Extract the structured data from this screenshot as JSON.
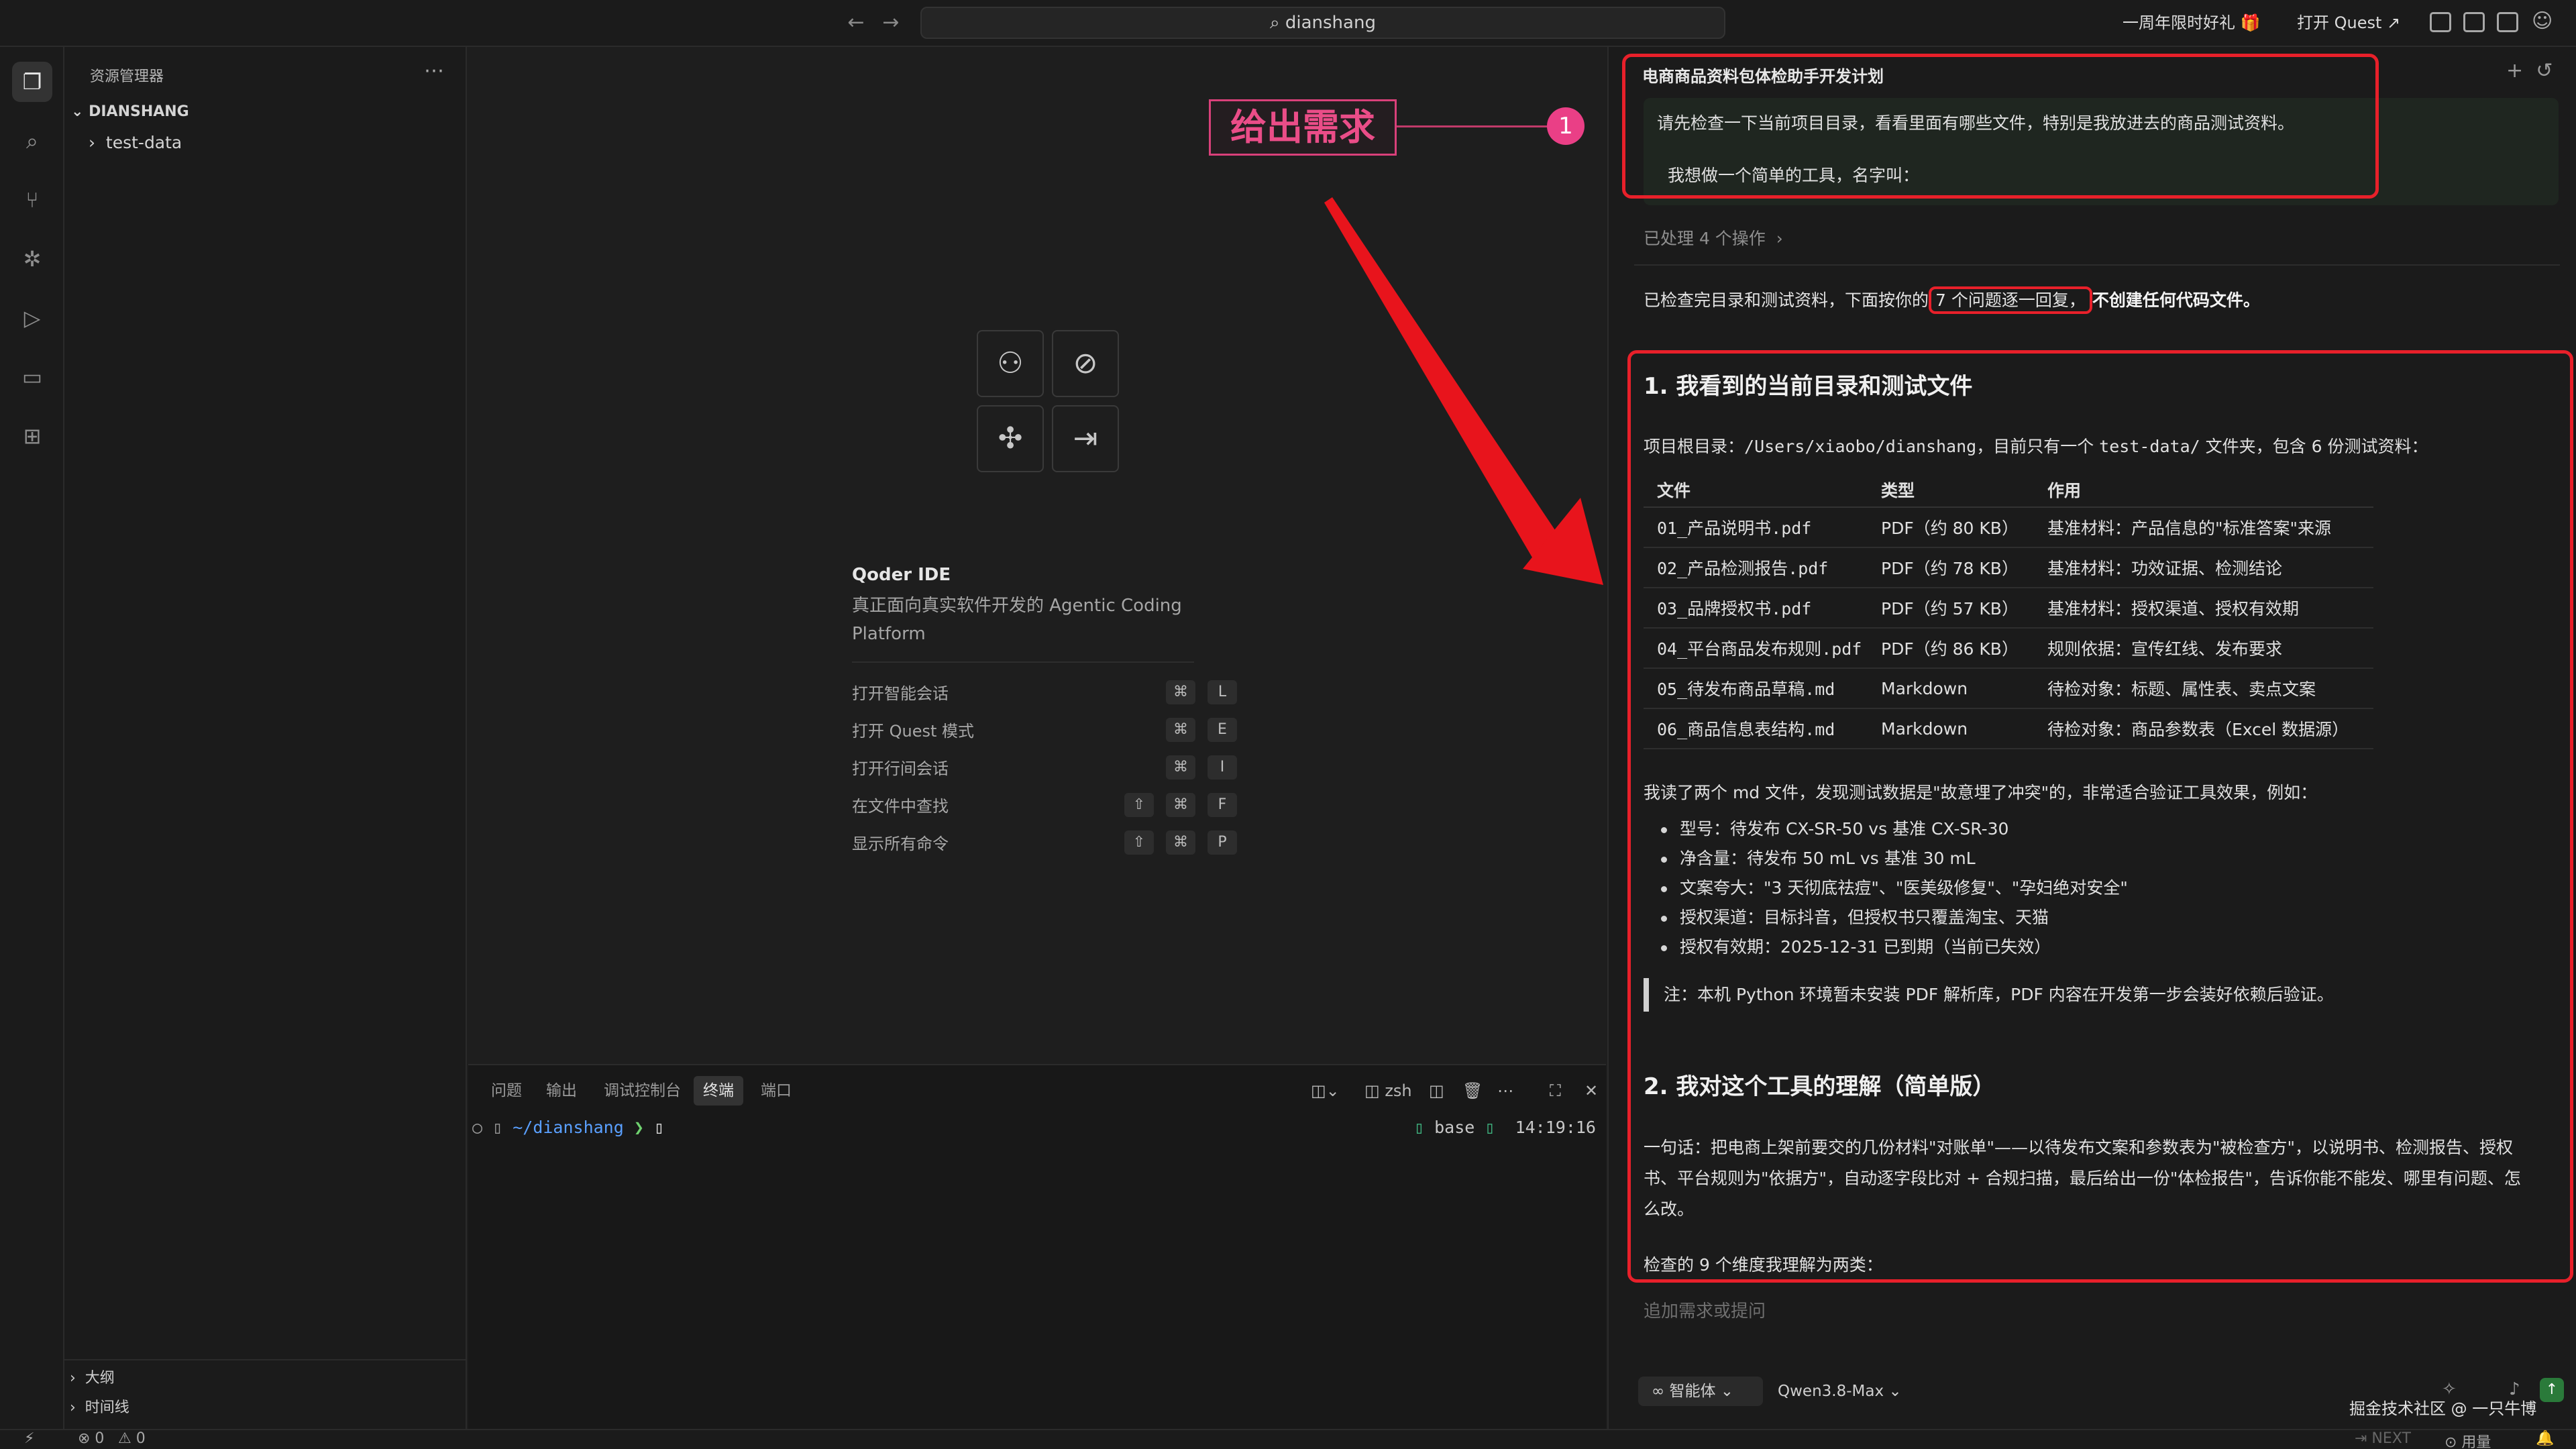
{
  "titlebar": {
    "search_text": "dianshang",
    "promo": "一周年限时好礼 🎁",
    "open_quest": "打开 Quest ↗"
  },
  "sidebar": {
    "title": "资源管理器",
    "root": "DIANSHANG",
    "items": [
      {
        "label": "test-data"
      }
    ],
    "outline": "大纲",
    "timeline": "时间线"
  },
  "welcome": {
    "title": "Qoder IDE",
    "subtitle": "真正面向真实软件开发的 Agentic Coding Platform",
    "shortcuts": [
      {
        "label": "打开智能会话",
        "keys": [
          "⌘",
          "L"
        ]
      },
      {
        "label": "打开 Quest 模式",
        "keys": [
          "⌘",
          "E"
        ]
      },
      {
        "label": "打开行间会话",
        "keys": [
          "⌘",
          "I"
        ]
      },
      {
        "label": "在文件中查找",
        "keys": [
          "⇧",
          "⌘",
          "F"
        ]
      },
      {
        "label": "显示所有命令",
        "keys": [
          "⇧",
          "⌘",
          "P"
        ]
      }
    ]
  },
  "annotation": {
    "label": "给出需求",
    "badge": "1"
  },
  "panel": {
    "tabs": [
      "问题",
      "输出",
      "调试控制台",
      "终端",
      "端口"
    ],
    "active_tab": "终端",
    "shell": "zsh",
    "prompt_path": "~/dianshang",
    "prompt_symbol": "❯",
    "env": "base",
    "time": "14:19:16"
  },
  "chat": {
    "title": "电商商品资料包体检助手开发计划",
    "user_msg": [
      "请先检查一下当前项目目录，看看里面有哪些文件，特别是我放进去的商品测试资料。",
      "我想做一个简单的工具，名字叫："
    ],
    "processed": "已处理 4 个操作",
    "intro_a": "已检查完目录和测试资料，下面按你的",
    "intro_b": "7 个问题逐一回复，",
    "intro_c": "不创建任何代码文件。",
    "section1_title": "1. 我看到的当前目录和测试文件",
    "root_dir_prefix": "项目根目录：",
    "root_dir_path": "/Users/xiaobo/dianshang",
    "root_dir_mid": "，目前只有一个",
    "root_dir_folder": "test-data/",
    "root_dir_suffix": "文件夹，包含 6 份测试资料：",
    "table": {
      "headers": [
        "文件",
        "类型",
        "作用"
      ],
      "rows": [
        [
          "01_产品说明书.pdf",
          "PDF（约 80 KB）",
          "基准材料：产品信息的\"标准答案\"来源"
        ],
        [
          "02_产品检测报告.pdf",
          "PDF（约 78 KB）",
          "基准材料：功效证据、检测结论"
        ],
        [
          "03_品牌授权书.pdf",
          "PDF（约 57 KB）",
          "基准材料：授权渠道、授权有效期"
        ],
        [
          "04_平台商品发布规则.pdf",
          "PDF（约 86 KB）",
          "规则依据：宣传红线、发布要求"
        ],
        [
          "05_待发布商品草稿.md",
          "Markdown",
          "待检对象：标题、属性表、卖点文案"
        ],
        [
          "06_商品信息表结构.md",
          "Markdown",
          "待检对象：商品参数表（Excel 数据源）"
        ]
      ]
    },
    "md_summary": "我读了两个 md 文件，发现测试数据是\"故意埋了冲突\"的，非常适合验证工具效果，例如：",
    "bullets": [
      "型号：待发布 CX-SR-50 vs 基准 CX-SR-30",
      "净含量：待发布 50 mL vs 基准 30 mL",
      "文案夸大：\"3 天彻底祛痘\"、\"医美级修复\"、\"孕妇绝对安全\"",
      "授权渠道：目标抖音，但授权书只覆盖淘宝、天猫",
      "授权有效期：2025-12-31 已到期（当前已失效）"
    ],
    "note": "注：本机 Python 环境暂未安装 PDF 解析库，PDF 内容在开发第一步会装好依赖后验证。",
    "section2_title": "2. 我对这个工具的理解（简单版）",
    "section2_para": [
      "一句话：把电商上架前要交的几份材料\"对账单\"——以待发布文案和参数表为\"被检查方\"，以说明书、检测报告、授权",
      "书、平台规则为\"依据方\"，自动逐字段比对 + 合规扫描，最后给出一份\"体检报告\"，告诉你能不能发、哪里有问题、怎",
      "么改。"
    ],
    "dims": "检查的 9 个维度我理解为两类：",
    "input_placeholder": "追加需求或提问",
    "agent_label": "∞ 智能体 ⌄",
    "model_label": "Qwen3.8-Max ⌄"
  },
  "statusbar": {
    "errors": "⊗ 0",
    "warnings": "⚠ 0",
    "next": "⇥ NEXT",
    "usage": "⊙ 用量"
  },
  "watermark": "掘金技术社区 @ 一只牛博"
}
